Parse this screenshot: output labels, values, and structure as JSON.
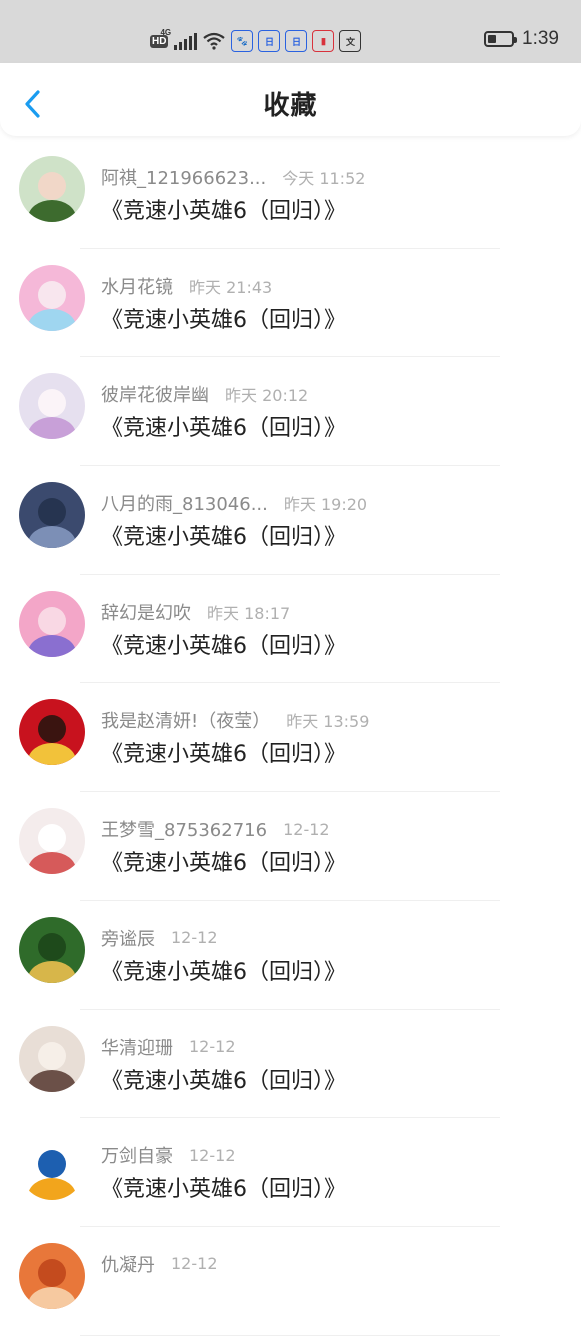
{
  "status_bar": {
    "network_badge": "HD",
    "network_type": "4G",
    "app_icons": [
      {
        "name": "baidu-icon",
        "glyph": "🐾",
        "color": "#2a62e0"
      },
      {
        "name": "calendar-icon-1",
        "glyph": "日",
        "color": "#2a62e0"
      },
      {
        "name": "calendar-icon-2",
        "glyph": "日",
        "color": "#2a62e0"
      },
      {
        "name": "book-icon",
        "glyph": "▮",
        "color": "#d8323c"
      },
      {
        "name": "translate-icon",
        "glyph": "文",
        "color": "#333333"
      }
    ],
    "battery_level": 0.35,
    "time": "1:39"
  },
  "header": {
    "title": "收藏",
    "back_icon": "chevron-left-icon",
    "accent_color": "#1a9cf0"
  },
  "items": [
    {
      "user": "阿祺_121966623...",
      "time": "今天 11:52",
      "title": "《竞速小英雄6（回归）》"
    },
    {
      "user": "水月花镜",
      "time": "昨天 21:43",
      "title": "《竞速小英雄6（回归）》"
    },
    {
      "user": "彼岸花彼岸幽",
      "time": "昨天 20:12",
      "title": "《竞速小英雄6（回归）》"
    },
    {
      "user": "八月的雨_813046...",
      "time": "昨天 19:20",
      "title": "《竞速小英雄6（回归）》"
    },
    {
      "user": "辞幻是幻吹",
      "time": "昨天 18:17",
      "title": "《竞速小英雄6（回归）》"
    },
    {
      "user": "我是赵清妍!（夜莹）",
      "time": "昨天 13:59",
      "title": "《竞速小英雄6（回归）》"
    },
    {
      "user": "王梦雪_875362716",
      "time": "12-12",
      "title": "《竞速小英雄6（回归）》"
    },
    {
      "user": "旁谧辰",
      "time": "12-12",
      "title": "《竞速小英雄6（回归）》"
    },
    {
      "user": "华清迎珊",
      "time": "12-12",
      "title": "《竞速小英雄6（回归）》"
    },
    {
      "user": "万剑自豪",
      "time": "12-12",
      "title": "《竞速小英雄6（回归）》"
    },
    {
      "user": "仇凝丹",
      "time": "12-12",
      "title": ""
    }
  ]
}
